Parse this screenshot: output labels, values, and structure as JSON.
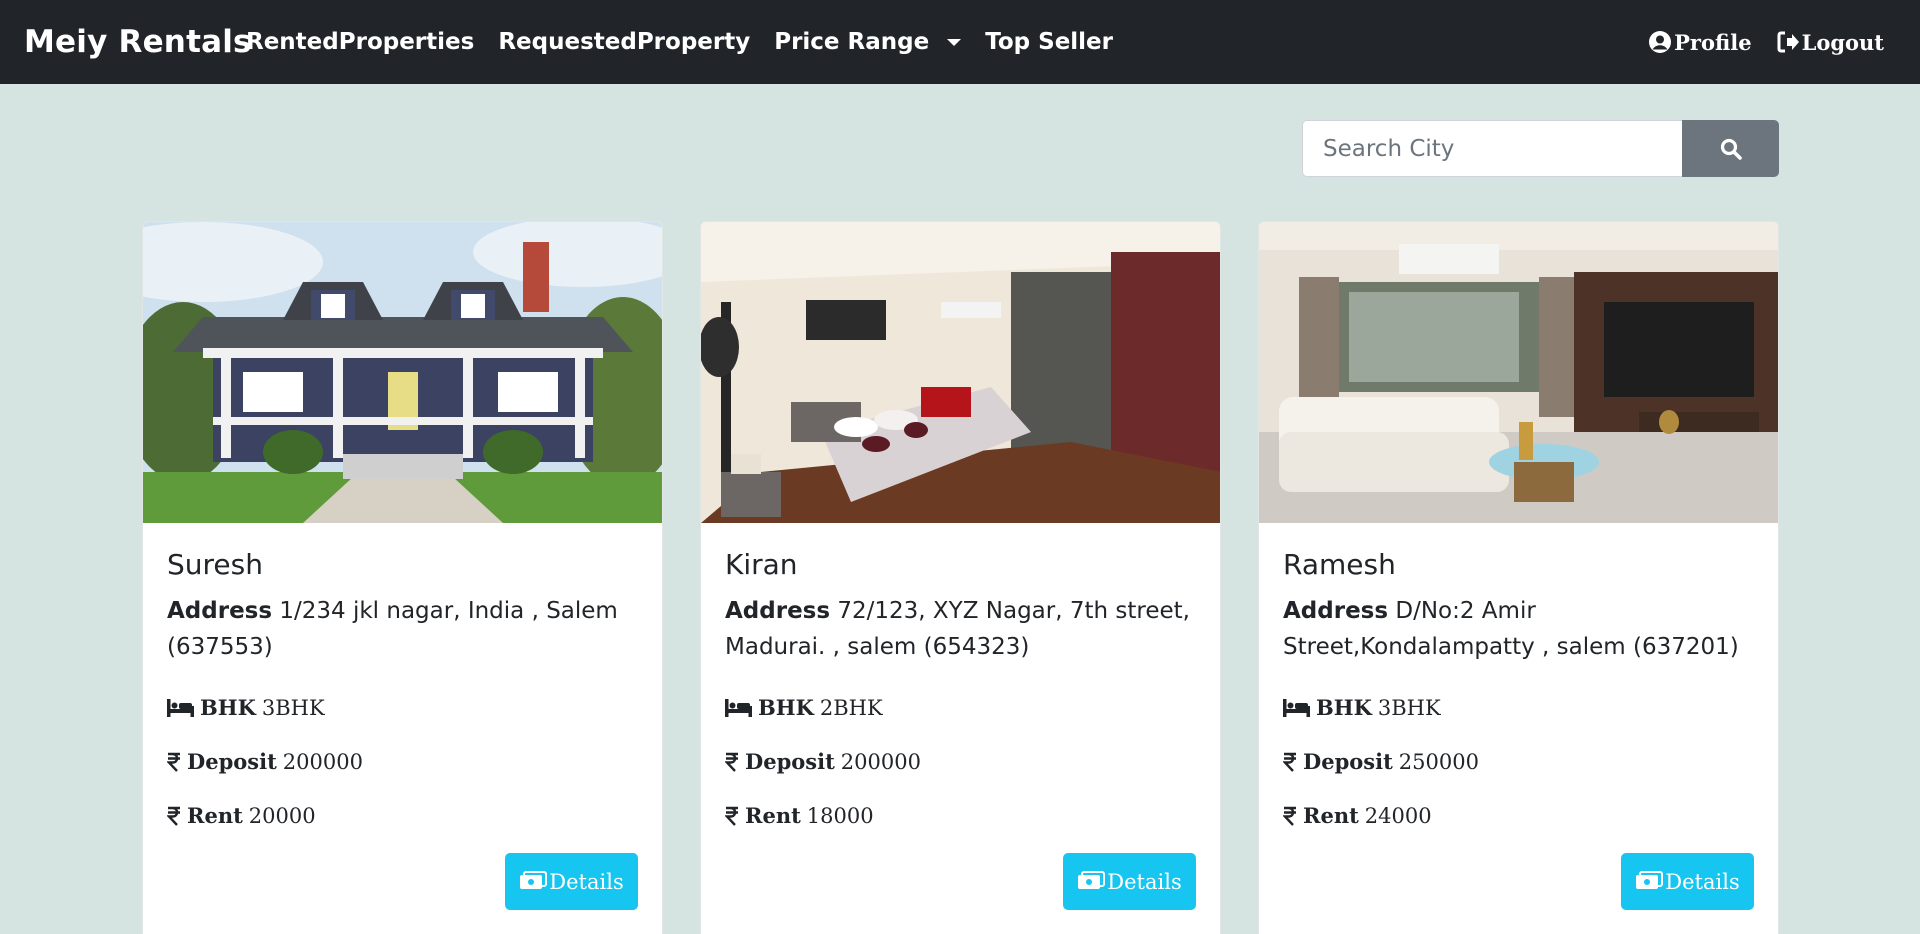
{
  "nav": {
    "brand": "Meiy Rentals",
    "links": [
      "RentedProperties",
      "RequestedProperty",
      "Price Range",
      "Top Seller"
    ],
    "profile": "Profile",
    "logout": "Logout"
  },
  "search": {
    "placeholder": "Search City"
  },
  "labels": {
    "address": "Address",
    "bhk": "BHK",
    "deposit": "Deposit",
    "rent": "Rent",
    "details": "Details"
  },
  "listings": [
    {
      "owner": "Suresh",
      "address": "1/234 jkl nagar, India , Salem (637553)",
      "bhk": "3BHK",
      "deposit": "200000",
      "rent": "20000",
      "image": "house-exterior"
    },
    {
      "owner": "Kiran",
      "address": "72/123, XYZ Nagar, 7th street, Madurai. , salem (654323)",
      "bhk": "2BHK",
      "deposit": "200000",
      "rent": "18000",
      "image": "bedroom"
    },
    {
      "owner": "Ramesh",
      "address": "D/No:2 Amir Street,Kondalampatty , salem (637201)",
      "bhk": "3BHK",
      "deposit": "250000",
      "rent": "24000",
      "image": "living-room"
    }
  ],
  "colors": {
    "navbar": "#212529",
    "background": "#d5e3e1",
    "details_button": "#17c6f0",
    "search_button": "#6c757d"
  },
  "icons": {
    "profile": "user-circle-icon",
    "logout": "sign-out-icon",
    "search": "search-icon",
    "bhk": "bed-icon",
    "money": "rupee-icon",
    "details": "money-check-icon"
  }
}
